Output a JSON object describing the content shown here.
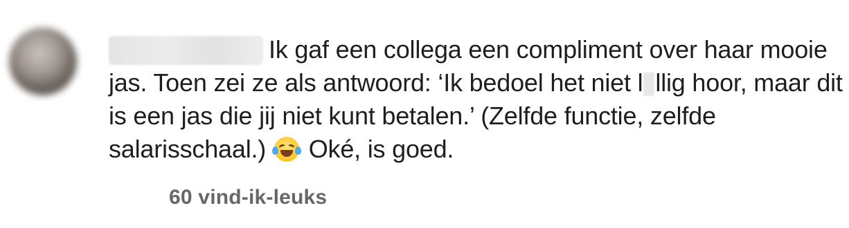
{
  "comment": {
    "text_part1": "Ik gaf een collega een compliment over haar mooie jas. Toen zei ze als antwoord: ‘Ik bedoel het niet l",
    "text_part2": "llig hoor, maar dit is een jas die jij niet kunt betalen.’ (Zelfde functie, zelfde salarisschaal.)",
    "emoji": "face-with-tears-of-joy",
    "text_part3": "Oké, is goed.",
    "likes_label": "60 vind-ik-leuks"
  },
  "colors": {
    "text": "#1c1e21",
    "secondary_text": "#65676b",
    "background": "#ffffff"
  }
}
